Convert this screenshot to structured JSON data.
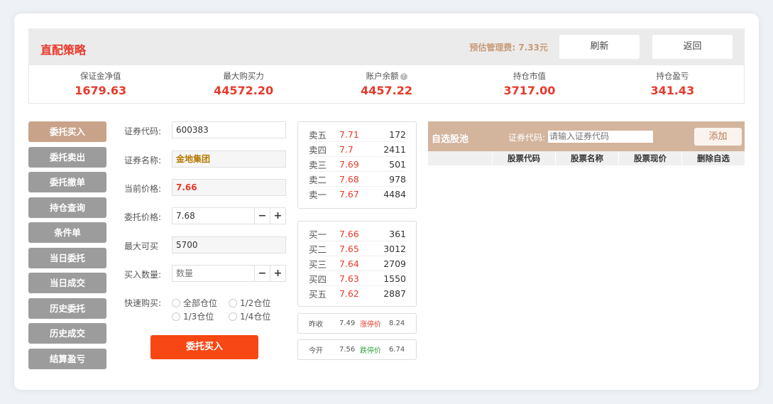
{
  "header": {
    "title": "直配策略",
    "fee_label": "预估管理费:",
    "fee_value": "7.33元",
    "refresh_label": "刷新",
    "back_label": "返回"
  },
  "stats": [
    {
      "label": "保证金净值",
      "value": "1679.63"
    },
    {
      "label": "最大购买力",
      "value": "44572.20"
    },
    {
      "label": "账户余额",
      "value": "4457.22"
    },
    {
      "label": "持仓市值",
      "value": "3717.00"
    },
    {
      "label": "持仓盈亏",
      "value": "341.43"
    }
  ],
  "nav": [
    "委托买入",
    "委托卖出",
    "委托撤单",
    "持仓查询",
    "条件单",
    "当日委托",
    "当日成交",
    "历史委托",
    "历史成交",
    "结算盈亏"
  ],
  "form": {
    "code_label": "证券代码:",
    "code_value": "600383",
    "name_label": "证券名称:",
    "name_value": "金地集团",
    "price_label": "当前价格:",
    "price_value": "7.66",
    "order_price_label": "委托价格:",
    "order_price_value": "7.68",
    "max_label": "最大可买",
    "max_value": "5700",
    "qty_label": "买入数量:",
    "qty_placeholder": "数量",
    "quick_label": "快速购买:",
    "quick_options": [
      "全部仓位",
      "1/2仓位",
      "1/3仓位",
      "1/4仓位"
    ],
    "minus": "−",
    "plus": "+",
    "submit_label": "委托买入"
  },
  "sell_book": [
    {
      "label": "卖五",
      "price": "7.71",
      "vol": "172"
    },
    {
      "label": "卖四",
      "price": "7.7",
      "vol": "2411"
    },
    {
      "label": "卖三",
      "price": "7.69",
      "vol": "501"
    },
    {
      "label": "卖二",
      "price": "7.68",
      "vol": "978"
    },
    {
      "label": "卖一",
      "price": "7.67",
      "vol": "4484"
    }
  ],
  "buy_book": [
    {
      "label": "买一",
      "price": "7.66",
      "vol": "361"
    },
    {
      "label": "买二",
      "price": "7.65",
      "vol": "3012"
    },
    {
      "label": "买三",
      "price": "7.64",
      "vol": "2709"
    },
    {
      "label": "买四",
      "price": "7.63",
      "vol": "1550"
    },
    {
      "label": "买五",
      "price": "7.62",
      "vol": "2887"
    }
  ],
  "quotes": {
    "prev_close_label": "昨收",
    "prev_close": "7.49",
    "limit_up_label": "涨停价",
    "limit_up": "8.24",
    "open_label": "今开",
    "open": "7.56",
    "limit_down_label": "跌停价",
    "limit_down": "6.74"
  },
  "watchlist": {
    "title": "自选股池",
    "code_label": "证券代码:",
    "placeholder": "请输入证券代码",
    "add_label": "添加",
    "columns": [
      "股票代码",
      "股票名称",
      "股票现价",
      "删除自选"
    ]
  },
  "colors": {
    "accent_red": "#e8392b",
    "buy_button": "#f74714",
    "nav_active": "#c8a38a",
    "nav_default": "#9c9c9c",
    "watch_bar": "#d3b49d",
    "limit_down_green": "#2e9e3c"
  }
}
